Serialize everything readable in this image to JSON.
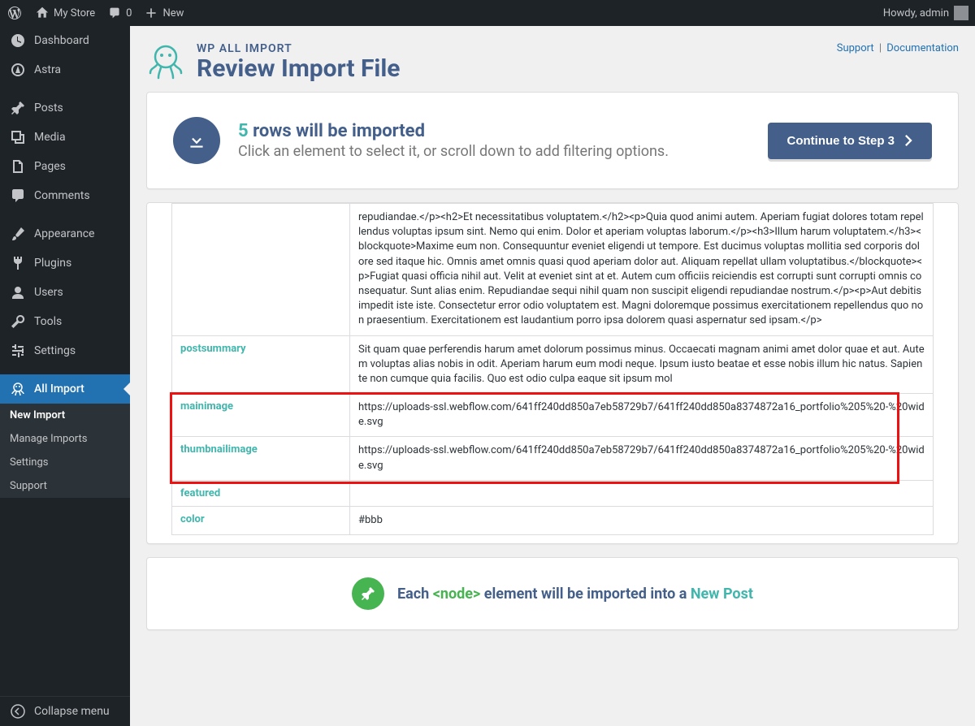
{
  "toolbar": {
    "site_name": "My Store",
    "comments": "0",
    "new": "New",
    "greeting": "Howdy, admin"
  },
  "sidebar": {
    "items": [
      {
        "label": "Dashboard"
      },
      {
        "label": "Astra"
      },
      {
        "label": "Posts"
      },
      {
        "label": "Media"
      },
      {
        "label": "Pages"
      },
      {
        "label": "Comments"
      },
      {
        "label": "Appearance"
      },
      {
        "label": "Plugins"
      },
      {
        "label": "Users"
      },
      {
        "label": "Tools"
      },
      {
        "label": "Settings"
      },
      {
        "label": "All Import"
      }
    ],
    "sub": [
      {
        "label": "New Import"
      },
      {
        "label": "Manage Imports"
      },
      {
        "label": "Settings"
      },
      {
        "label": "Support"
      }
    ],
    "collapse": "Collapse menu"
  },
  "header": {
    "brand_sub": "WP ALL IMPORT",
    "brand_title": "Review Import File",
    "links": {
      "support": "Support",
      "docs": "Documentation"
    }
  },
  "info": {
    "count": "5",
    "title": " rows will be imported",
    "sub": "Click an element to select it, or scroll down to add filtering options.",
    "button": "Continue to Step 3"
  },
  "table": {
    "rows": [
      {
        "key": "",
        "value": "repudiandae.</p><h2>Et necessitatibus voluptatem.</h2><p>Quia quod animi autem. Aperiam fugiat dolores totam repellendus voluptas ipsum sint. Nemo qui enim. Dolor et aperiam voluptas laborum.</p><h3>Illum harum voluptatem.</h3><blockquote>Maxime eum non. Consequuntur eveniet eligendi ut tempore. Est ducimus voluptas mollitia sed corporis dolore sed itaque hic. Omnis amet omnis quasi quod aperiam dolor aut. Aliquam repellat ullam voluptatibus.</blockquote><p>Fugiat quasi officia nihil aut. Velit at eveniet sint at et. Autem cum officiis reiciendis est corrupti sunt corrupti omnis consequatur. Sunt alias enim. Repudiandae sequi nihil quam non suscipit eligendi repudiandae nostrum.</p><p>Aut debitis impedit iste iste. Consectetur error odio voluptatem est. Magni doloremque possimus exercitationem repellendus quo non praesentium. Exercitationem est laudantium porro ipsa dolorem quasi aspernatur sed ipsam.</p>"
      },
      {
        "key": "postsummary",
        "value": "Sit quam quae perferendis harum amet dolorum possimus minus. Occaecati magnam animi amet dolor quae et aut. Autem voluptas alias nobis in odit. Aperiam harum eum modi neque. Ipsum iusto beatae et esse nobis illum hic natus. Sapiente non cumque quia facilis. Quo est odio culpa eaque sit ipsum mol"
      },
      {
        "key": "mainimage",
        "value": "https://uploads-ssl.webflow.com/641ff240dd850a7eb58729b7/641ff240dd850a8374872a16_portfolio%205%20-%20wide.svg"
      },
      {
        "key": "thumbnailimage",
        "value": "https://uploads-ssl.webflow.com/641ff240dd850a7eb58729b7/641ff240dd850a8374872a16_portfolio%205%20-%20wide.svg"
      },
      {
        "key": "featured",
        "value": ""
      },
      {
        "key": "color",
        "value": "#bbb"
      }
    ]
  },
  "footer": {
    "pre": "Each ",
    "node": "<node>",
    "mid": " element will be imported into a ",
    "tail": "New Post"
  }
}
